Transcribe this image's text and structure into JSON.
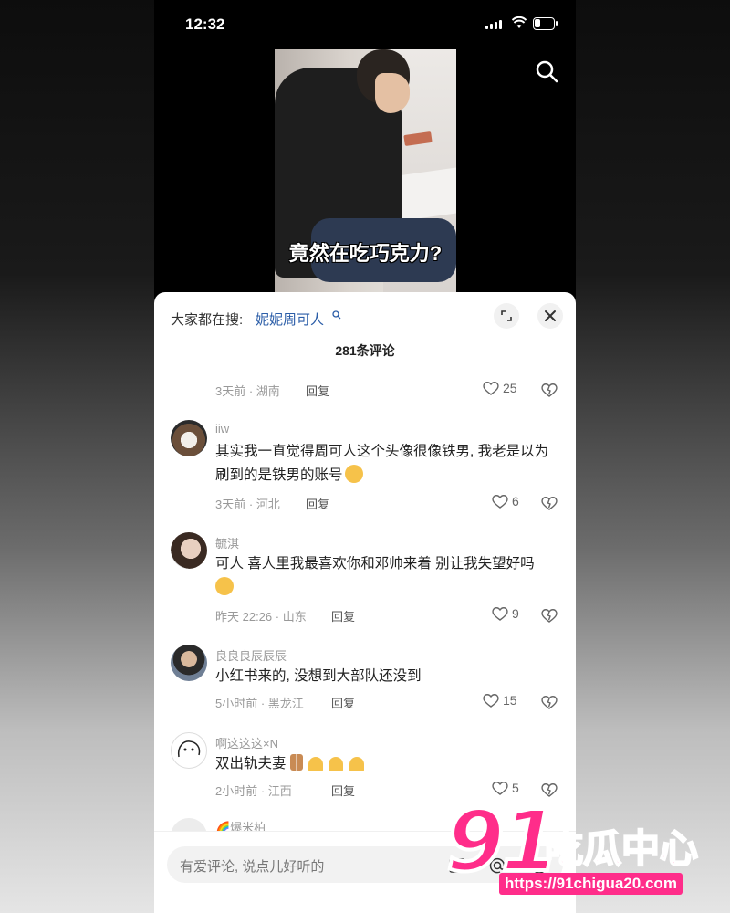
{
  "status_bar": {
    "time": "12:32"
  },
  "video": {
    "caption": "竟然在吃巧克力?"
  },
  "comments_sheet": {
    "trending_label": "大家都在搜:",
    "trending_term": "妮妮周可人",
    "count_label": "281条评论",
    "comments": [
      {
        "user": "",
        "text": "",
        "meta": "3天前 · 湖南",
        "reply": "回复",
        "likes": "25"
      },
      {
        "user": "iiw",
        "text": "其实我一直觉得周可人这个头像很像铁男, 我老是以为刷到的是铁男的账号",
        "meta": "3天前 · 河北",
        "reply": "回复",
        "likes": "6"
      },
      {
        "user": "毓淇",
        "text": "可人 喜人里我最喜欢你和邓帅来着 别让我失望好吗",
        "meta": "昨天 22:26 · 山东",
        "reply": "回复",
        "likes": "9"
      },
      {
        "user": "良良良辰辰辰",
        "text": "小红书来的, 没想到大部队还没到",
        "meta": "5小时前 · 黑龙江",
        "reply": "回复",
        "likes": "15"
      },
      {
        "user": "啊这这这×N",
        "text": "双出轨夫妻",
        "meta": "2小时前 · 江西",
        "reply": "回复",
        "likes": "5"
      },
      {
        "user": "🌈爆米柏",
        "text": "",
        "meta": "",
        "reply": "",
        "likes": ""
      }
    ],
    "input_placeholder": "有爱评论, 说点儿好听的"
  },
  "watermark": {
    "brand": "91",
    "brand_cn": "吃瓜中心",
    "url": "https://91chigua20.com"
  },
  "colors": {
    "accent_link": "#2c5ea8",
    "watermark": "#ff2d8a"
  }
}
